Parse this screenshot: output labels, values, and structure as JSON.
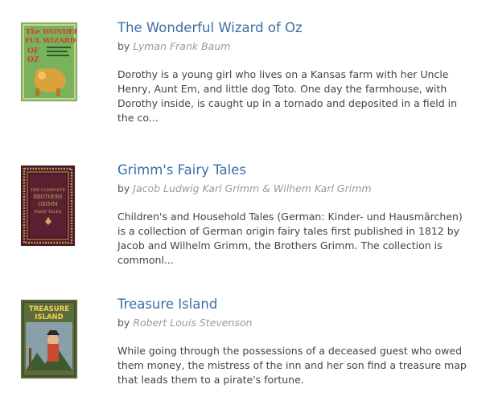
{
  "books": [
    {
      "title": "The Wonderful Wizard of Oz",
      "by": "by",
      "author": "Lyman Frank Baum",
      "description": "Dorothy is a young girl who lives on a Kansas farm with her Uncle Henry, Aunt Em, and little dog Toto. One day the farmhouse, with Dorothy inside, is caught up in a tornado and deposited in a field in the co...",
      "cover": {
        "line1": "The WONDER-",
        "line2": "FUL WIZARD",
        "line3": "OF",
        "line4": "OZ",
        "colors": {
          "bg": "#78b35c",
          "accent": "#d7392c",
          "frame": "#e9d9a8",
          "lion": "#d9a23a"
        }
      }
    },
    {
      "title": "Grimm's Fairy Tales",
      "by": "by",
      "author": "Jacob Ludwig Karl Grimm & Wilhem Karl Grimm",
      "description": "Children's and Household Tales (German: Kinder- und Hausmärchen) is a collection of German origin fairy tales first published in 1812 by Jacob and Wilhelm Grimm, the Brothers Grimm. The collection is commonl...",
      "cover": {
        "line1": "THE COMPLETE",
        "line2": "BROTHERS",
        "line3": "GRIMM",
        "line4": "FAIRY TALES",
        "colors": {
          "bg": "#4a1a26",
          "border": "#c39a56",
          "inner": "#5a2230"
        }
      }
    },
    {
      "title": "Treasure Island",
      "by": "by",
      "author": "Robert Louis Stevenson",
      "description": "While going through the possessions of a deceased guest who owed them money, the mistress of the inn and her son find a treasure map that leads them to a pirate's fortune.",
      "cover": {
        "line1": "TREASURE",
        "line2": "ISLAND",
        "colors": {
          "bg": "#5b6b3a",
          "title": "#f4d25a",
          "pirate": "#c84a2e",
          "sky": "#8aa0a8"
        }
      }
    }
  ]
}
